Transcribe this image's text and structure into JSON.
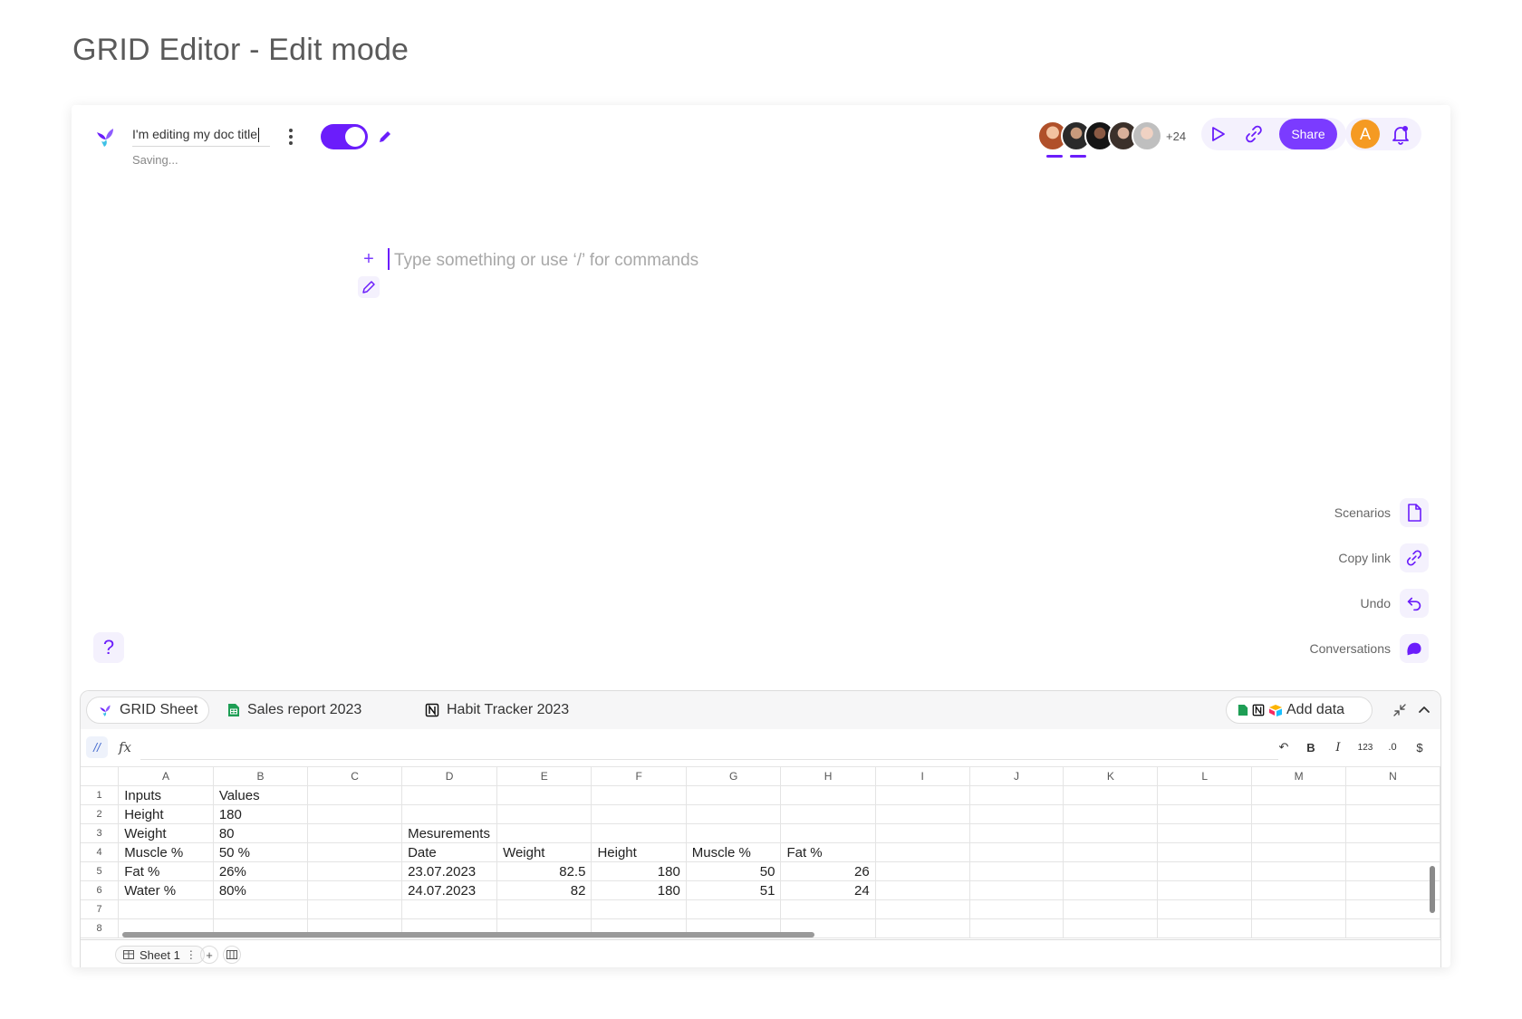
{
  "page": {
    "title": "GRID Editor - Edit mode"
  },
  "header": {
    "doc_title": "I'm editing my doc title",
    "status": "Saving...",
    "collaborators_more": "+24",
    "share_label": "Share",
    "user_initial": "A"
  },
  "editor": {
    "placeholder": "Type something or use ‘/’ for commands"
  },
  "side_actions": [
    {
      "label": "Scenarios",
      "icon": "document-icon"
    },
    {
      "label": "Copy link",
      "icon": "link-icon"
    },
    {
      "label": "Undo",
      "icon": "undo-icon"
    },
    {
      "label": "Conversations",
      "icon": "chat-icon"
    }
  ],
  "help": {
    "label": "?"
  },
  "sheet_panel": {
    "tabs": [
      {
        "label": "GRID Sheet",
        "icon": "grid-logo-icon",
        "active": true
      },
      {
        "label": "Sales report 2023",
        "icon": "google-sheets-icon",
        "active": false
      },
      {
        "label": "Habit Tracker 2023",
        "icon": "notion-icon",
        "active": false
      }
    ],
    "add_data_label": "Add data",
    "formula": {
      "grid_fn": "//",
      "fx": "fx",
      "value": ""
    },
    "format_tools": [
      "↶",
      "B",
      "I",
      "123",
      ".0",
      "$"
    ],
    "columns": [
      "A",
      "B",
      "C",
      "D",
      "E",
      "F",
      "G",
      "H",
      "I",
      "J",
      "K",
      "L",
      "M",
      "N"
    ],
    "rows": [
      {
        "n": "1",
        "cells": [
          "Inputs",
          "Values",
          "",
          "",
          "",
          "",
          "",
          "",
          "",
          "",
          "",
          "",
          "",
          ""
        ]
      },
      {
        "n": "2",
        "cells": [
          "Height",
          "180",
          "",
          "",
          "",
          "",
          "",
          "",
          "",
          "",
          "",
          "",
          "",
          ""
        ]
      },
      {
        "n": "3",
        "cells": [
          "Weight",
          "80",
          "",
          "Mesurements",
          "",
          "",
          "",
          "",
          "",
          "",
          "",
          "",
          "",
          ""
        ]
      },
      {
        "n": "4",
        "cells": [
          "Muscle %",
          "50 %",
          "",
          "Date",
          "Weight",
          "Height",
          "Muscle %",
          "Fat %",
          "",
          "",
          "",
          "",
          "",
          ""
        ]
      },
      {
        "n": "5",
        "cells": [
          "Fat %",
          "26%",
          "",
          "23.07.2023",
          "82.5",
          "180",
          "50",
          "26",
          "",
          "",
          "",
          "",
          "",
          ""
        ]
      },
      {
        "n": "6",
        "cells": [
          "Water %",
          "80%",
          "",
          "24.07.2023",
          "82",
          "180",
          "51",
          "24",
          "",
          "",
          "",
          "",
          "",
          ""
        ]
      },
      {
        "n": "7",
        "cells": [
          "",
          "",
          "",
          "",
          "",
          "",
          "",
          "",
          "",
          "",
          "",
          "",
          "",
          ""
        ]
      },
      {
        "n": "8",
        "cells": [
          "",
          "",
          "",
          "",
          "",
          "",
          "",
          "",
          "",
          "",
          "",
          "",
          "",
          ""
        ]
      }
    ],
    "sheet_name": "Sheet 1",
    "footer_add": "+"
  },
  "colors": {
    "accent": "#6b1dfb",
    "share": "#7b3bff",
    "user_avatar": "#f59a22",
    "tint": "#f4f1fd"
  }
}
